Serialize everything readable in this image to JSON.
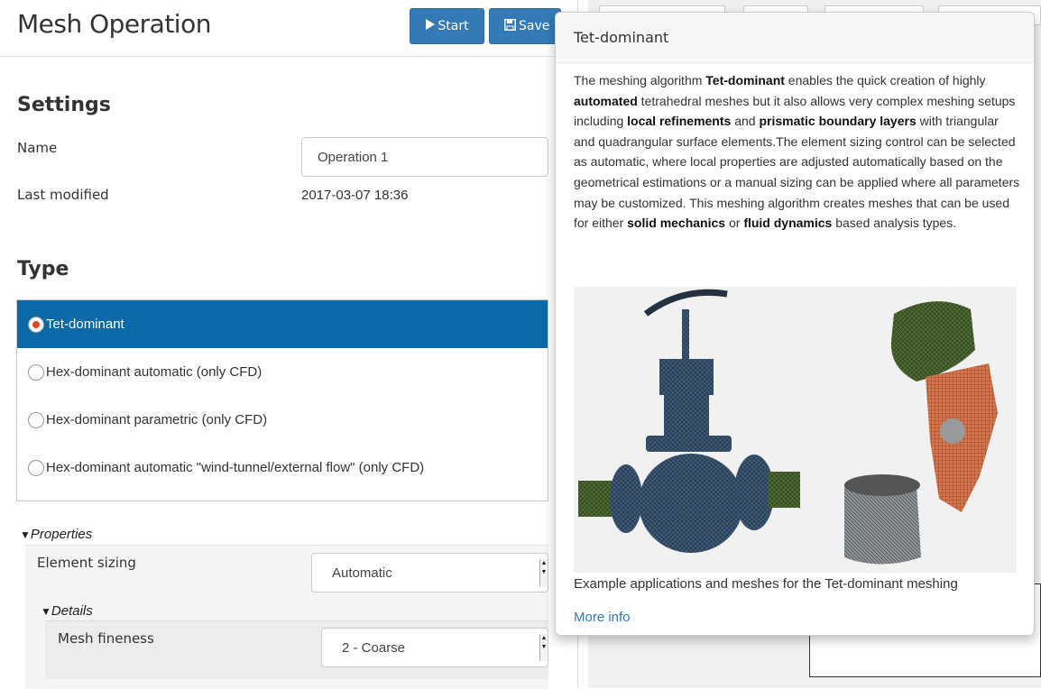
{
  "header": {
    "title": "Mesh Operation",
    "start_label": "Start",
    "save_label": "Save"
  },
  "settings": {
    "heading": "Settings",
    "name_label": "Name",
    "name_value": "Operation 1",
    "last_modified_label": "Last modified",
    "last_modified_value": "2017-03-07 18:36"
  },
  "type": {
    "heading": "Type",
    "options": [
      {
        "label": "Tet-dominant",
        "selected": true
      },
      {
        "label": "Hex-dominant automatic (only CFD)",
        "selected": false
      },
      {
        "label": "Hex-dominant parametric (only CFD)",
        "selected": false
      },
      {
        "label": "Hex-dominant automatic \"wind-tunnel/external flow\" (only CFD)",
        "selected": false
      }
    ]
  },
  "properties": {
    "title": "Properties",
    "element_sizing_label": "Element sizing",
    "element_sizing_value": "Automatic",
    "details": {
      "title": "Details",
      "mesh_fineness_label": "Mesh fineness",
      "mesh_fineness_value": "2 - Coarse"
    }
  },
  "popover": {
    "title": "Tet-dominant",
    "body": [
      {
        "t": "The meshing algorithm ",
        "b": false
      },
      {
        "t": "Tet-dominant",
        "b": true
      },
      {
        "t": " enables the quick creation of highly ",
        "b": false
      },
      {
        "t": "automated",
        "b": true
      },
      {
        "t": " tetrahedral meshes but it also allows very complex meshing setups including ",
        "b": false
      },
      {
        "t": "local refinements",
        "b": true
      },
      {
        "t": " and ",
        "b": false
      },
      {
        "t": "prismatic boundary layers",
        "b": true
      },
      {
        "t": " with triangular and quadrangular surface elements.The element sizing control can be selected as automatic, where local properties are adjusted automatically based on the geometrical estimations or a manual sizing can be applied where all parameters may be customized. This meshing algorithm creates meshes that can be used for either ",
        "b": false
      },
      {
        "t": "solid mechanics",
        "b": true
      },
      {
        "t": " or ",
        "b": false
      },
      {
        "t": "fluid dynamics",
        "b": true
      },
      {
        "t": " based analysis types.",
        "b": false
      }
    ],
    "image_caption": "Example applications and meshes for the Tet-dominant meshing",
    "more_info_label": "More info"
  },
  "colors": {
    "primary": "#337ab7",
    "selected_row": "#0a69a6",
    "radio_dot": "#e2452a"
  }
}
